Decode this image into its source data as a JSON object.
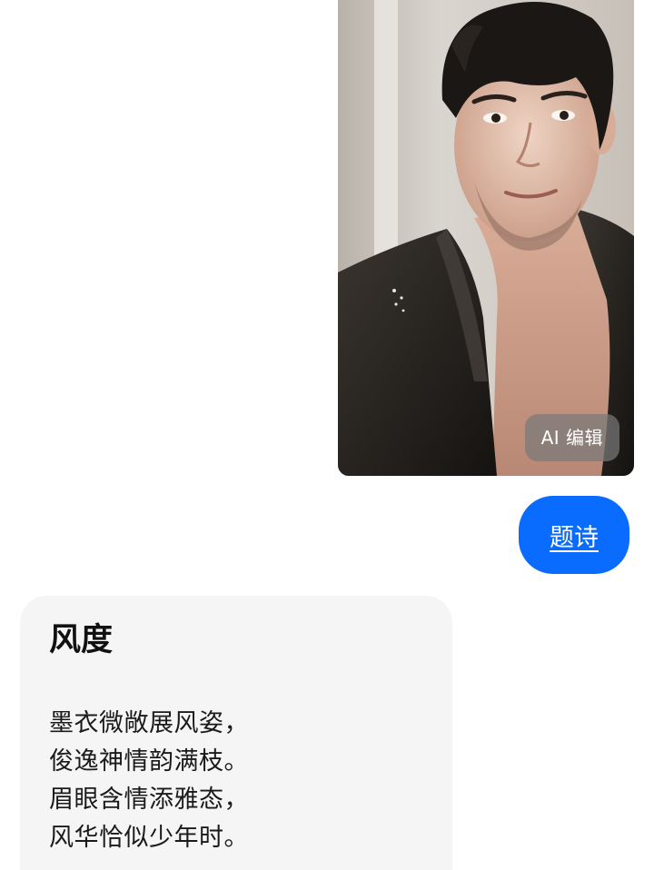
{
  "photo_message": {
    "ai_edit_label": "AI 编辑"
  },
  "command_bubble": {
    "text": "题诗"
  },
  "poem": {
    "title": "风度",
    "lines": [
      "墨衣微敞展风姿，",
      "俊逸神情韵满枝。",
      "眉眼含情添雅态，",
      "风华恰似少年时。"
    ]
  },
  "colors": {
    "accent": "#0a6cff",
    "card_background": "#f5f5f5",
    "ai_button_background": "#787878"
  }
}
